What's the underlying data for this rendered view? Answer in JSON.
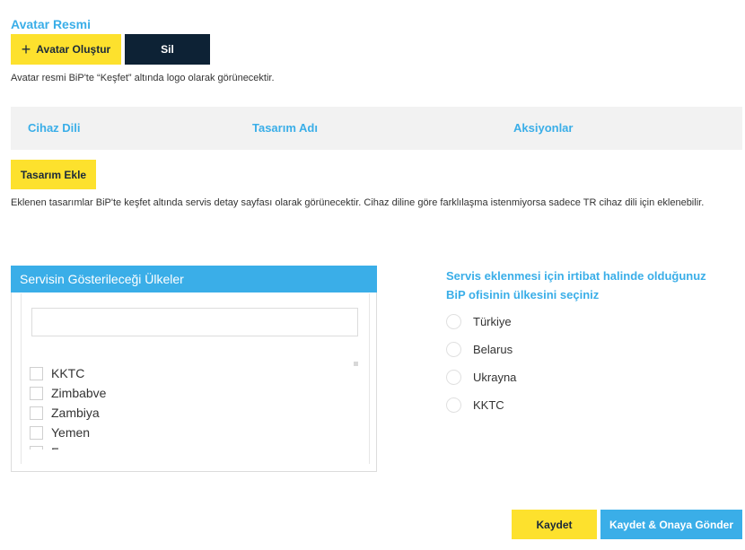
{
  "avatar": {
    "title": "Avatar Resmi",
    "create_label": "Avatar Oluştur",
    "delete_label": "Sil",
    "note": "Avatar resmi BiP'te “Keşfet” altında logo olarak görünecektir."
  },
  "designs": {
    "columns": [
      "Cihaz Dili",
      "Tasarım Adı",
      "Aksiyonlar"
    ],
    "add_label": "Tasarım Ekle",
    "note": "Eklenen tasarımlar BiP'te keşfet altında servis detay sayfası olarak görünecektir. Cihaz diline göre farklılaşma istenmiyorsa sadece TR cihaz dili için eklenebilir."
  },
  "countries_panel": {
    "title": "Servisin Gösterileceği Ülkeler",
    "search_value": "",
    "items": [
      "KKTC",
      "Zimbabve",
      "Zambiya",
      "Yemen",
      "Faş"
    ]
  },
  "office": {
    "title": "Servis eklenmesi için irtibat halinde olduğunuz BiP ofisinin ülkesini seçiniz",
    "options": [
      "Türkiye",
      "Belarus",
      "Ukrayna",
      "KKTC"
    ]
  },
  "footer": {
    "save_label": "Kaydet",
    "save_submit_label": "Kaydet & Onaya Gönder"
  }
}
